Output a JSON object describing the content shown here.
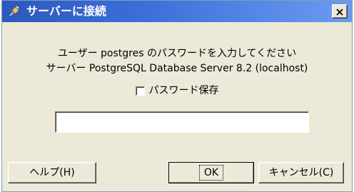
{
  "window": {
    "title": "サーバーに接続",
    "close_glyph": "✕"
  },
  "prompt": {
    "line1": "ユーザー postgres のパスワードを入力してください",
    "line2": "サーバー PostgreSQL Database Server 8.2 (localhost)"
  },
  "save_password": {
    "label": "パスワード保存",
    "checked": false
  },
  "password_field": {
    "value": ""
  },
  "buttons": {
    "help": "ヘルプ(H)",
    "ok": "OK",
    "cancel": "キャンセル(C)"
  },
  "icons": {
    "title_icon": "plug-icon",
    "close_icon": "close-icon"
  }
}
